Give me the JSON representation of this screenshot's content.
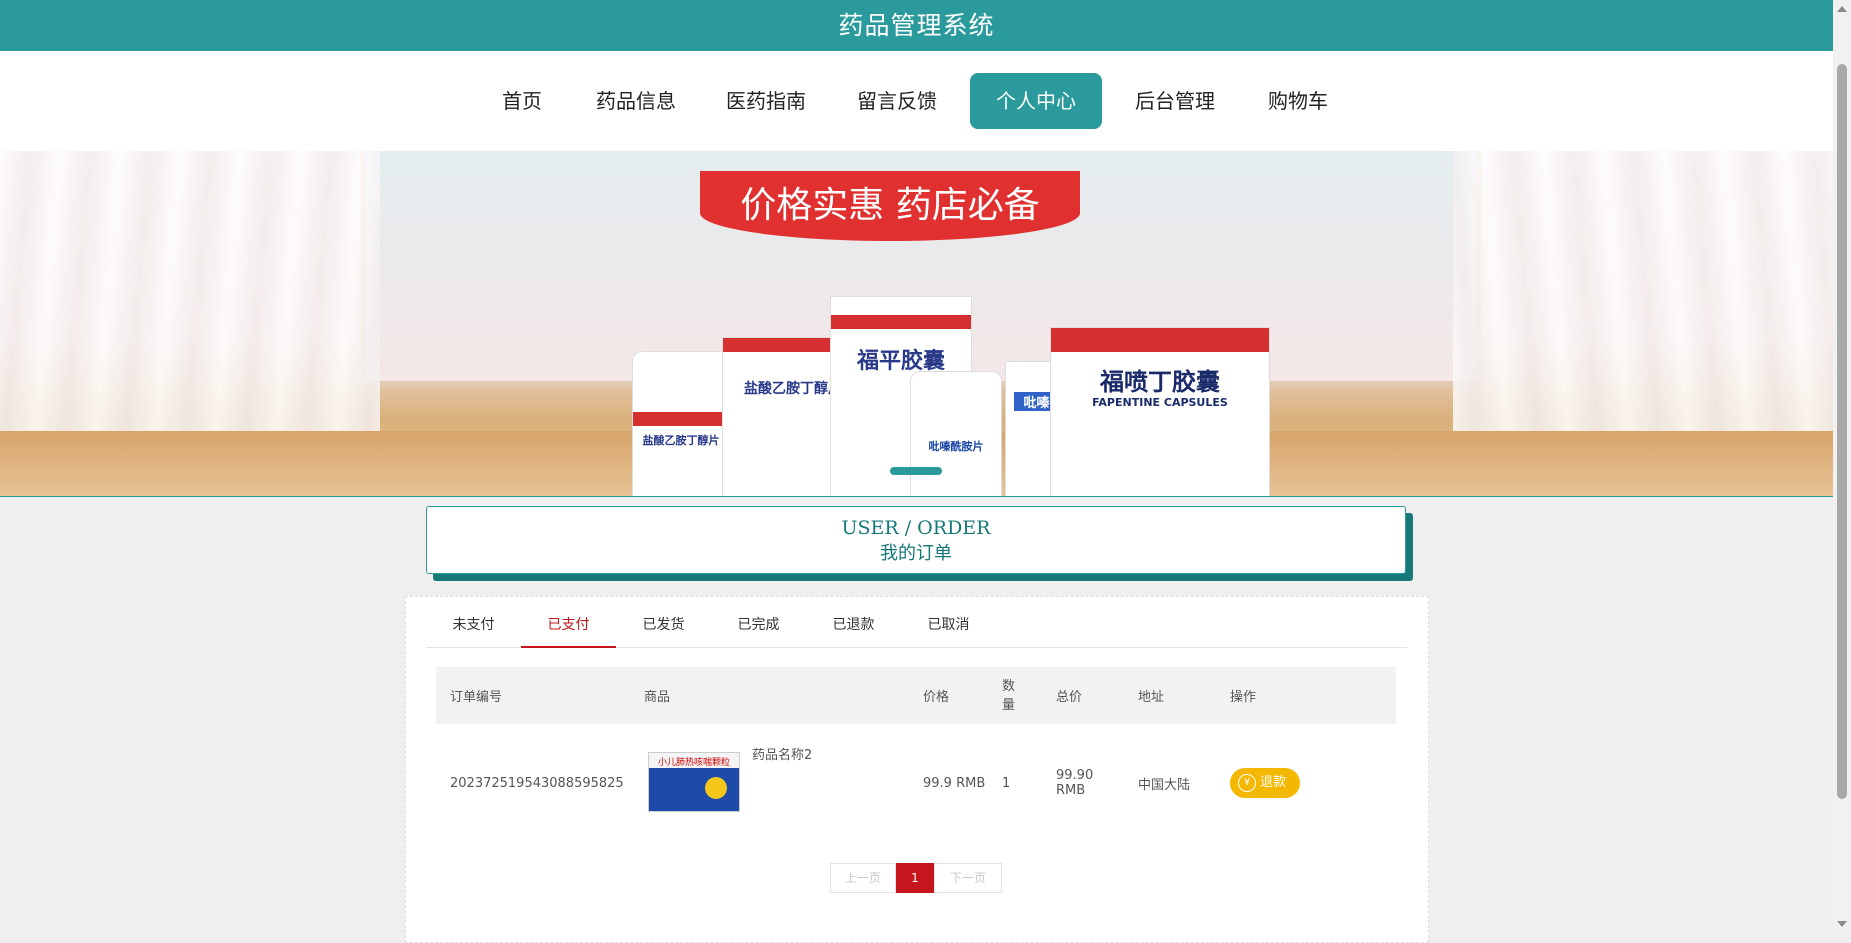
{
  "app": {
    "title": "药品管理系统"
  },
  "nav": {
    "items": [
      {
        "label": "首页"
      },
      {
        "label": "药品信息"
      },
      {
        "label": "医药指南"
      },
      {
        "label": "留言反馈"
      },
      {
        "label": "个人中心",
        "active": true
      },
      {
        "label": "后台管理"
      },
      {
        "label": "购物车"
      }
    ]
  },
  "banner": {
    "slogan": "价格实惠 药店必备",
    "boxes": [
      "盐酸乙胺丁醇片",
      "福平胶囊",
      "吡嗪酰胺片",
      "福喷丁胶囊",
      "FAPENTINE CAPSULES"
    ]
  },
  "heading": {
    "en": "USER / ORDER",
    "cn": "我的订单"
  },
  "tabs": [
    {
      "label": "未支付"
    },
    {
      "label": "已支付",
      "active": true
    },
    {
      "label": "已发货"
    },
    {
      "label": "已完成"
    },
    {
      "label": "已退款"
    },
    {
      "label": "已取消"
    }
  ],
  "table": {
    "headers": {
      "order_no": "订单编号",
      "product": "商品",
      "price": "价格",
      "qty": "数量",
      "total": "总价",
      "address": "地址",
      "action": "操作"
    },
    "rows": [
      {
        "order_no": "20237251954308859582​5",
        "product_name": "药品名称2",
        "product_img_text": "小儿肺热咳喘颗粒",
        "price": "99.9 RMB",
        "qty": "1",
        "total": "99.90 RMB",
        "address": "中国大陆",
        "action": "退款"
      }
    ]
  },
  "pager": {
    "prev": "上一页",
    "current": "1",
    "next": "下一页"
  },
  "colors": {
    "primary": "#2a9a9c",
    "active_tab": "#c4161c",
    "refund": "#f5b800"
  }
}
